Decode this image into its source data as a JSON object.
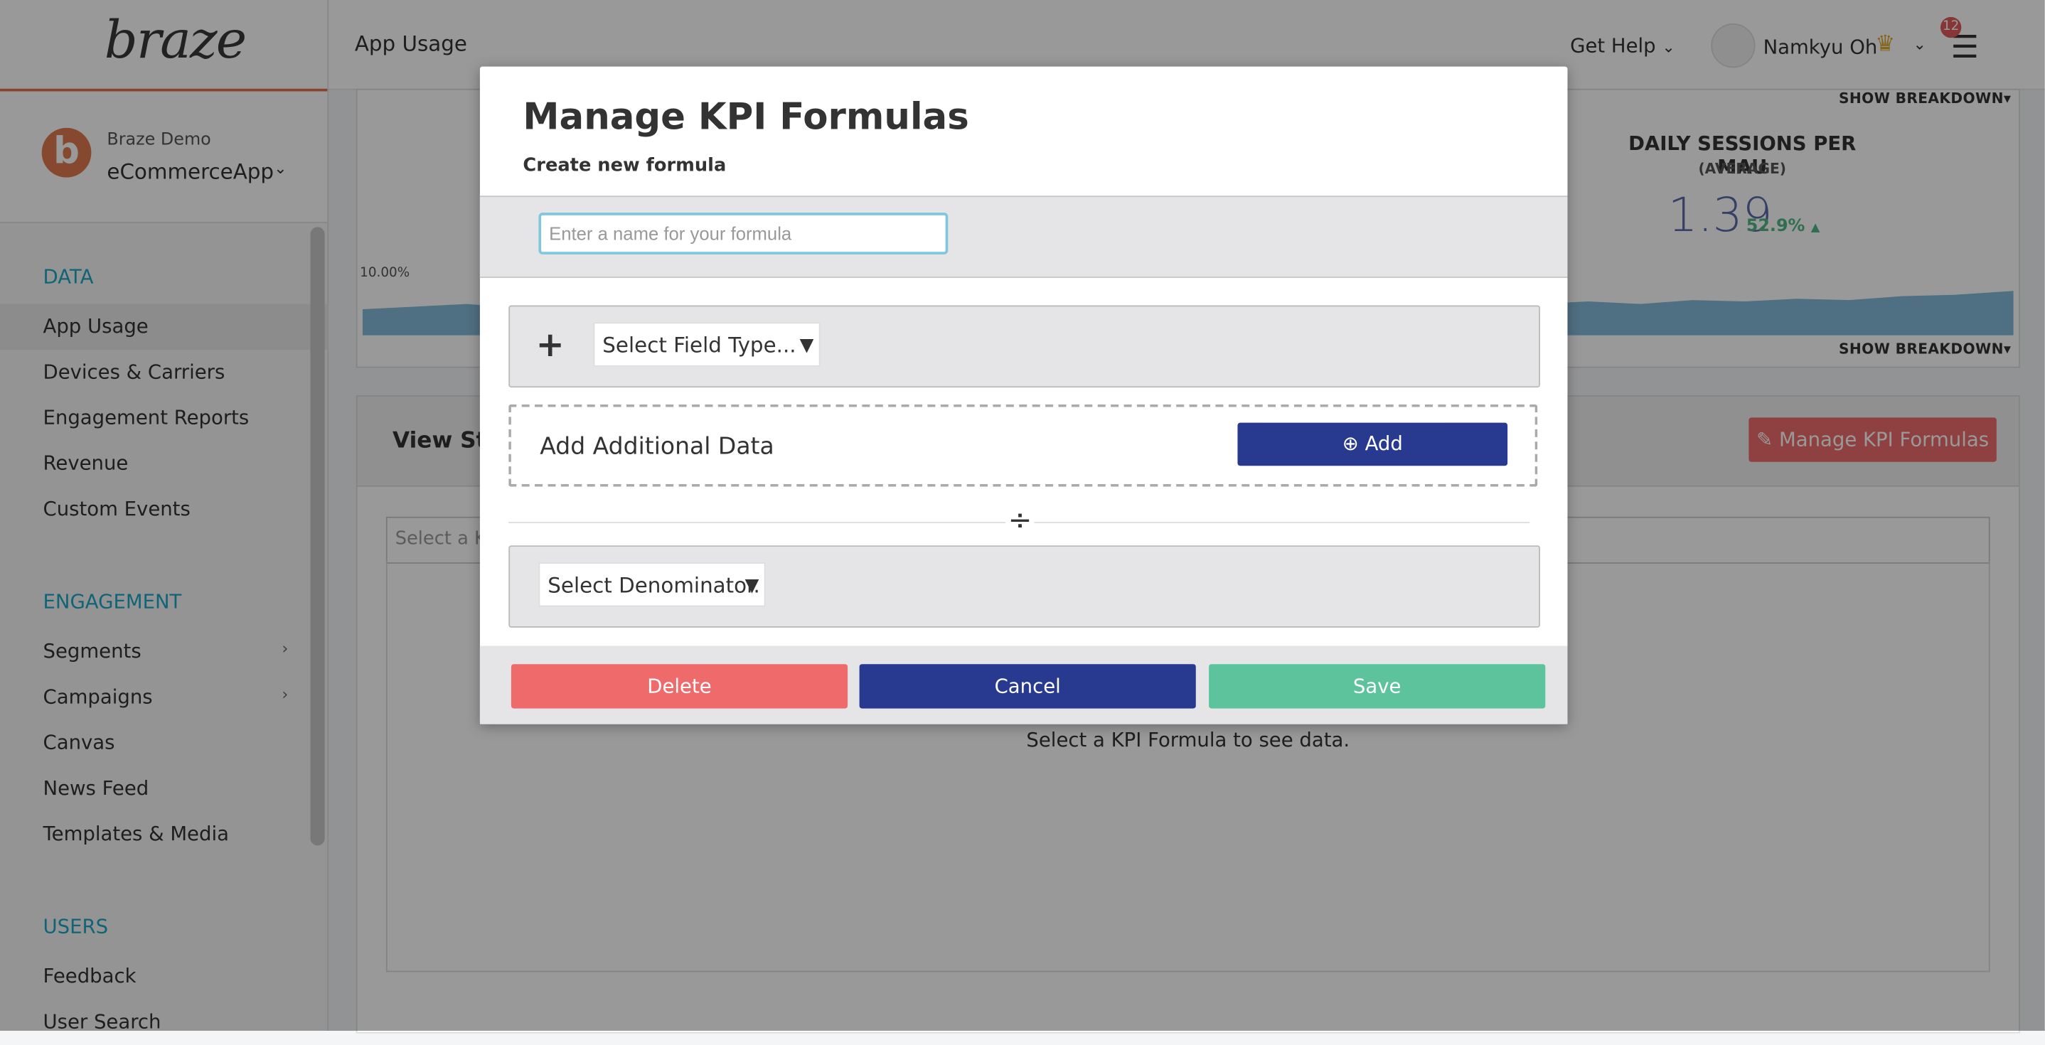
{
  "sidebar": {
    "logo_text": "braze",
    "company": "Braze Demo",
    "app_name": "eCommerceApp",
    "avatar_letter": "b",
    "sections": {
      "data": "DATA",
      "engagement": "ENGAGEMENT",
      "users": "USERS"
    },
    "data_items": [
      "App Usage",
      "Devices & Carriers",
      "Engagement Reports",
      "Revenue",
      "Custom Events"
    ],
    "engagement_items": [
      "Segments",
      "Campaigns",
      "Canvas",
      "News Feed",
      "Templates & Media"
    ],
    "users_items": [
      "Feedback",
      "User Search"
    ]
  },
  "header": {
    "title": "App Usage",
    "help": "Get Help",
    "user": "Namkyu Oh",
    "notifications": "12"
  },
  "stats": {
    "show_breakdown": "SHOW BREAKDOWN",
    "kpi_title": "DAILY SESSIONS PER MAU",
    "kpi_sub": "(AVERAGE)",
    "kpi_value": "1.39",
    "kpi_change": "52.9%",
    "pct_label": "10.00%"
  },
  "view_stats": {
    "title": "View Sta",
    "manage_btn": "Manage KPI Formulas",
    "select_placeholder": "Select a Ki",
    "empty": "Select a KPI Formula to see data."
  },
  "modal": {
    "title": "Manage KPI Formulas",
    "subtitle": "Create new formula",
    "name_placeholder": "Enter a name for your formula",
    "field_type": "Select Field Type...",
    "add_label": "Add Additional Data",
    "add_btn": "Add",
    "denominator": "Select Denominator.",
    "delete": "Delete",
    "cancel": "Cancel",
    "save": "Save"
  },
  "colors": {
    "accent_teal": "#1ba7c4",
    "delete": "#ef6b6b",
    "primary": "#283a90",
    "save": "#5dc39c"
  }
}
